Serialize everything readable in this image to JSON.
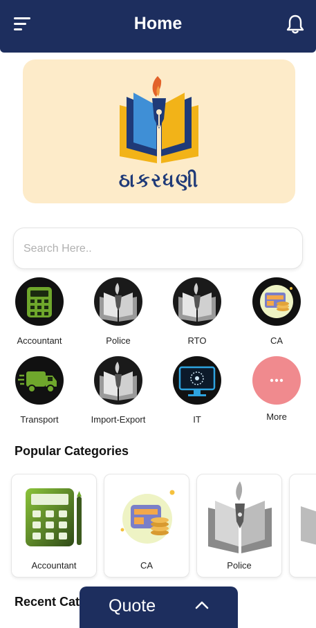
{
  "header": {
    "title": "Home"
  },
  "banner": {
    "brand_text": "ઠાકરધણી"
  },
  "search": {
    "placeholder": "Search Here.."
  },
  "categories": [
    {
      "label": "Accountant",
      "icon": "calculator-icon"
    },
    {
      "label": "Police",
      "icon": "book-pen-icon"
    },
    {
      "label": "RTO",
      "icon": "book-pen-icon"
    },
    {
      "label": "CA",
      "icon": "finance-icon"
    },
    {
      "label": "Transport",
      "icon": "truck-icon"
    },
    {
      "label": "Import-Export",
      "icon": "book-pen-icon"
    },
    {
      "label": "IT",
      "icon": "monitor-icon"
    },
    {
      "label": "More",
      "icon": "more-dots-icon"
    }
  ],
  "popular": {
    "title": "Popular Categories",
    "items": [
      {
        "label": "Accountant",
        "icon": "calculator-icon"
      },
      {
        "label": "CA",
        "icon": "finance-icon"
      },
      {
        "label": "Police",
        "icon": "book-pen-icon"
      }
    ]
  },
  "recent": {
    "title": "Recent Categories"
  },
  "quote": {
    "label": "Quote",
    "icon": "chevron-up-icon"
  },
  "colors": {
    "primary": "#1d2e5e",
    "banner_bg": "#fdebc9",
    "more_circle": "#f08a8e",
    "logo_blue": "#1f3a78"
  }
}
